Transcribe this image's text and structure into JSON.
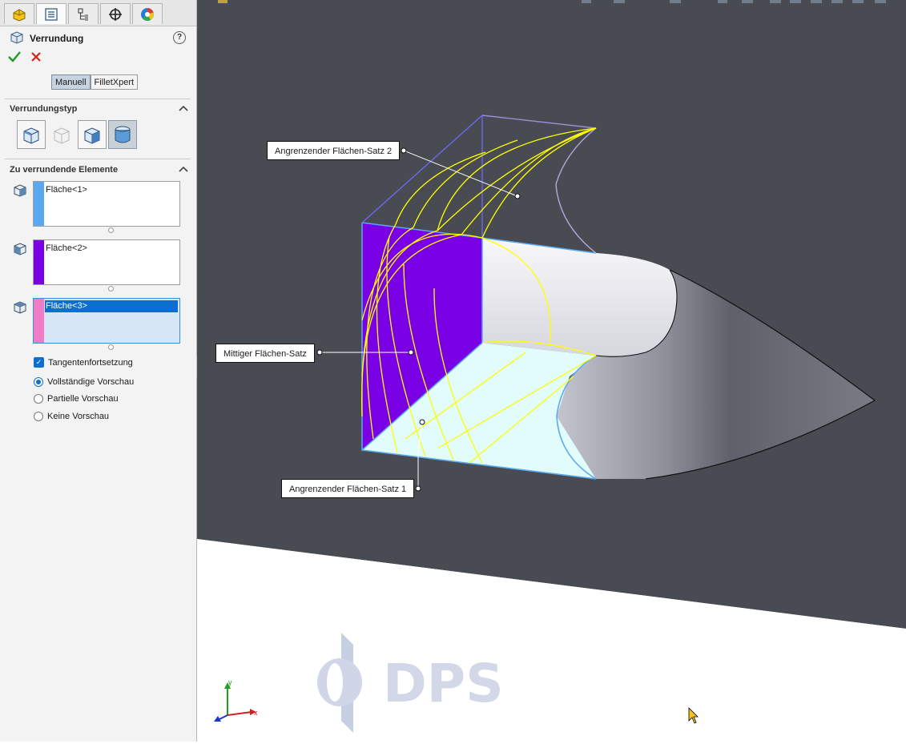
{
  "panel": {
    "tabs": [
      {
        "name": "feature-manager-tab",
        "icon": "part-icon"
      },
      {
        "name": "property-manager-tab",
        "icon": "property-sheet-icon"
      },
      {
        "name": "configuration-manager-tab",
        "icon": "configuration-icon"
      },
      {
        "name": "dimxpert-tab",
        "icon": "crosshair-icon"
      },
      {
        "name": "display-manager-tab",
        "icon": "appearance-pie-icon"
      }
    ],
    "title": "Verrundung",
    "help_icon": "help-icon",
    "ok_icon": "checkmark-icon",
    "cancel_icon": "close-icon",
    "mode_tabs": [
      "Manuell",
      "FilletXpert"
    ],
    "mode_selected": "Manuell",
    "section_type": {
      "title": "Verrundungstyp",
      "selected_index": 3
    },
    "section_items": {
      "title": "Zu verrundende Elemente",
      "face_sets": [
        {
          "label": "Fläche<1>",
          "color": "#5aa9f0",
          "selected": false
        },
        {
          "label": "Fläche<2>",
          "color": "#7a00e6",
          "selected": false
        },
        {
          "label": "Fläche<3>",
          "color": "#f07cc8",
          "selected": true
        }
      ]
    },
    "options": {
      "tangent_propagation": {
        "label": "Tangentenfortsetzung",
        "checked": true
      },
      "preview": {
        "choices": [
          "Vollständige Vorschau",
          "Partielle Vorschau",
          "Keine Vorschau"
        ],
        "selected": "Vollständige Vorschau"
      }
    }
  },
  "viewport": {
    "callouts": {
      "adjacent_set_2": "Angrenzender Flächen-Satz 2",
      "middle_set": "Mittiger Flächen-Satz",
      "adjacent_set_1": "Angrenzender Flächen-Satz 1"
    },
    "colors": {
      "background_dark": "#494b52",
      "floor": "#ffffff",
      "middle_face": "#7a00e6",
      "adjacent_face": "#e2fcfc",
      "preview_lines": "#ffff00",
      "selection_edge": "#5aa9f0"
    },
    "triad": {
      "x": "x",
      "y": "y"
    },
    "watermark": "DPS"
  }
}
